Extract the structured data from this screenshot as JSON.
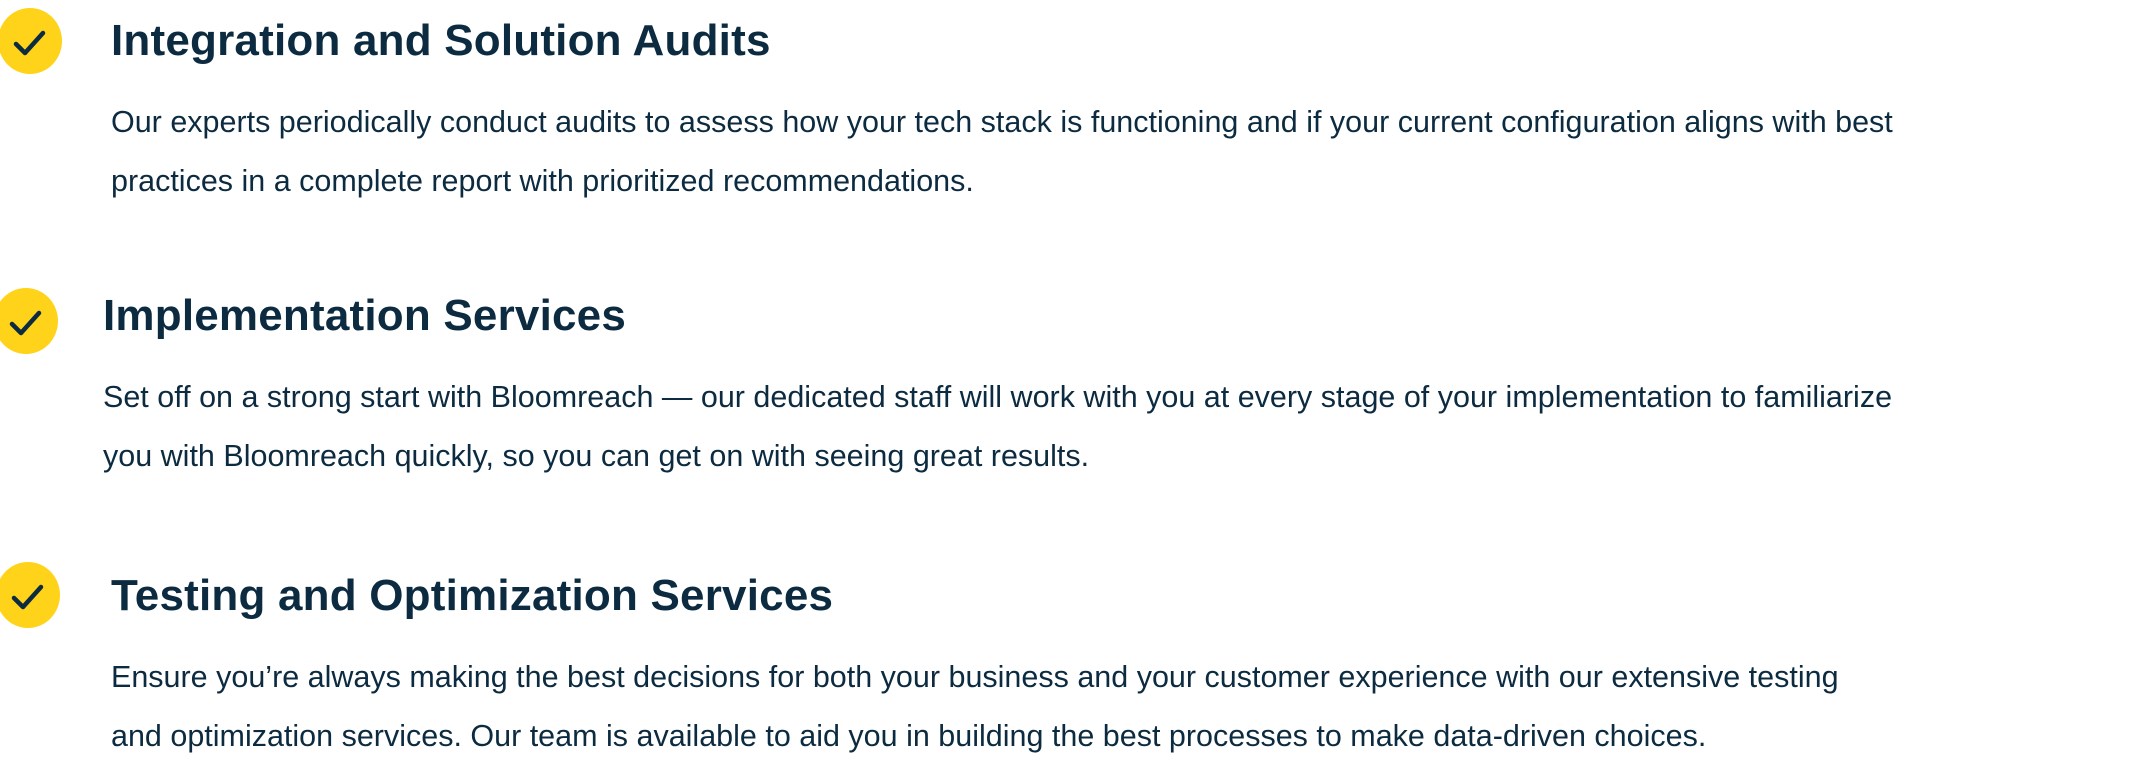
{
  "colors": {
    "accent": "#ffd31a",
    "text": "#0c2b40"
  },
  "features": [
    {
      "icon": "check-icon",
      "title": "Integration and Solution Audits",
      "lines": [
        "Our experts periodically conduct audits to assess how your tech stack is functioning and if your current configuration aligns with best",
        "practices in a complete report with prioritized recommendations."
      ]
    },
    {
      "icon": "check-icon",
      "title": "Implementation Services",
      "lines": [
        "Set off on a strong start with Bloomreach — our dedicated staff will work with you at every stage of your implementation to familiarize",
        "you with Bloomreach quickly, so you can get on with seeing great results."
      ]
    },
    {
      "icon": "check-icon",
      "title": "Testing and Optimization Services",
      "lines": [
        "Ensure you’re always making the best decisions for both your business and your customer experience with our extensive testing",
        "and optimization services. Our team is available to aid you in building the best processes to make data-driven choices."
      ]
    }
  ]
}
